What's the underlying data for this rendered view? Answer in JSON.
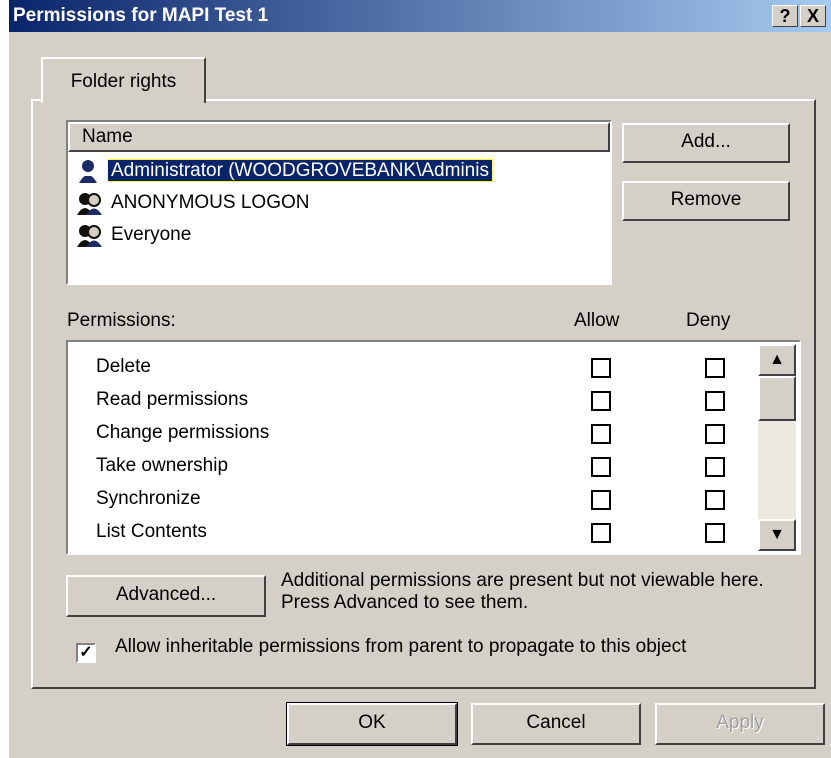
{
  "window": {
    "title": "Permissions for MAPI Test 1",
    "help_label": "?",
    "close_label": "X"
  },
  "tabs": [
    {
      "label": "Folder rights"
    }
  ],
  "users": {
    "column_header": "Name",
    "items": [
      {
        "name": "Administrator (WOODGROVEBANK\\Adminis",
        "icon": "user-icon",
        "selected": true
      },
      {
        "name": "ANONYMOUS LOGON",
        "icon": "group-icon",
        "selected": false
      },
      {
        "name": "Everyone",
        "icon": "group-icon",
        "selected": false
      }
    ]
  },
  "buttons": {
    "add": "Add...",
    "remove": "Remove",
    "advanced": "Advanced...",
    "ok": "OK",
    "cancel": "Cancel",
    "apply": "Apply"
  },
  "permissions": {
    "label": "Permissions:",
    "allow_header": "Allow",
    "deny_header": "Deny",
    "items": [
      {
        "name": "Delete",
        "allow": false,
        "deny": false
      },
      {
        "name": "Read permissions",
        "allow": false,
        "deny": false
      },
      {
        "name": "Change permissions",
        "allow": false,
        "deny": false
      },
      {
        "name": "Take ownership",
        "allow": false,
        "deny": false
      },
      {
        "name": "Synchronize",
        "allow": false,
        "deny": false
      },
      {
        "name": "List Contents",
        "allow": false,
        "deny": false
      }
    ]
  },
  "advanced_note": "Additional permissions are present but not viewable here. Press Advanced to see them.",
  "inherit": {
    "checked": true,
    "label": "Allow inheritable permissions from parent to propagate to this object"
  },
  "colors": {
    "title_bar": "#0a246a",
    "face": "#d4d0c8",
    "selection": "#0a246a"
  }
}
